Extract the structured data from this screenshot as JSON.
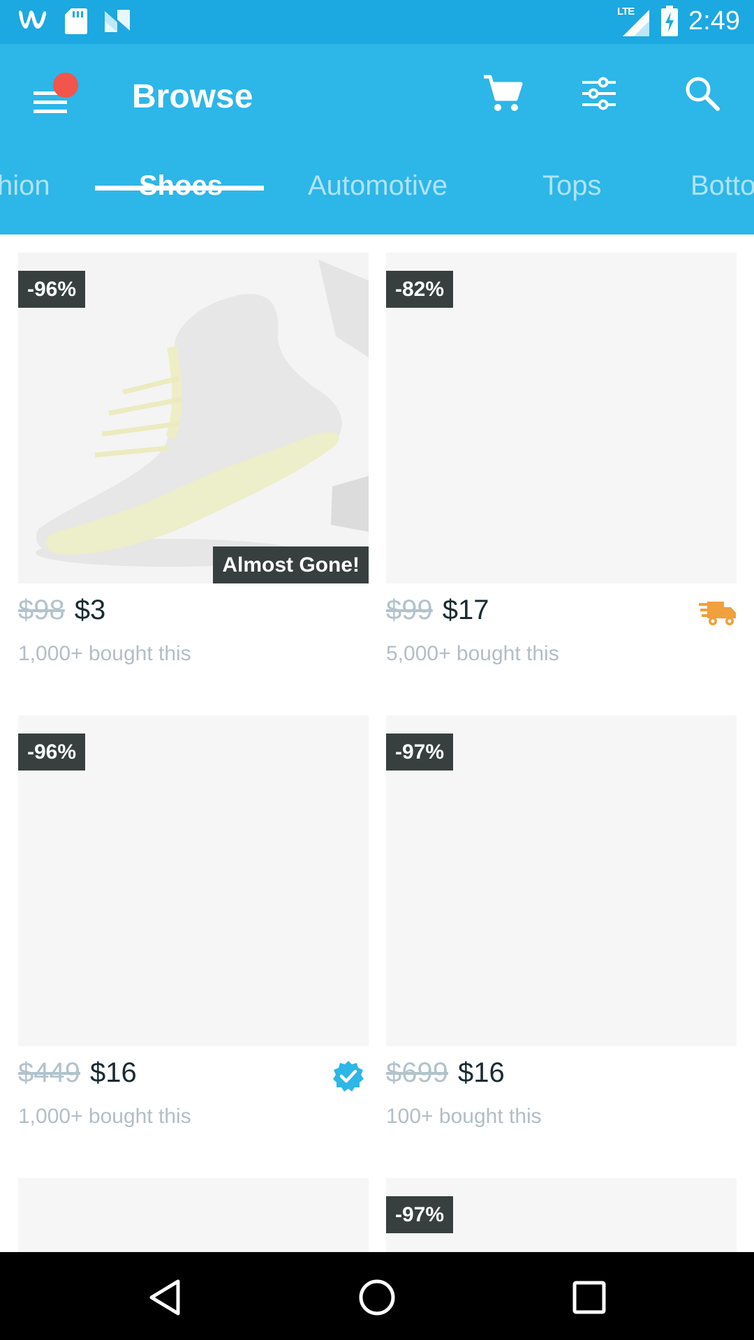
{
  "status_bar": {
    "time": "2:49",
    "network_label": "LTE",
    "left_icons": [
      "wish-logo-icon",
      "sd-card-icon",
      "n-logo-icon"
    ],
    "right_icons": [
      "lte-signal-icon",
      "battery-charging-icon"
    ]
  },
  "app_bar": {
    "title": "Browse",
    "background_color": "#2db6e8",
    "status_bar_color": "#1ca8e0",
    "notification_dot_color": "#f2554c",
    "actions": [
      "cart-icon",
      "filter-icon",
      "search-icon"
    ]
  },
  "tabs": {
    "items": [
      {
        "label": "hion"
      },
      {
        "label": "Shoes",
        "active": true
      },
      {
        "label": "Automotive"
      },
      {
        "label": "Tops"
      },
      {
        "label": "Botto"
      }
    ]
  },
  "products": [
    {
      "discount": "-96%",
      "old_price": "$98",
      "price": "$3",
      "bought": "1,000+ bought this",
      "tag": "Almost Gone!",
      "icon": "shoe-image"
    },
    {
      "discount": "-82%",
      "old_price": "$99",
      "price": "$17",
      "bought": "5,000+ bought this",
      "icon": "fast-shipping-truck-icon"
    },
    {
      "discount": "-96%",
      "old_price": "$449",
      "price": "$16",
      "bought": "1,000+ bought this",
      "icon": "verified-badge-icon"
    },
    {
      "discount": "-97%",
      "old_price": "$699",
      "price": "$16",
      "bought": "100+ bought this"
    },
    {
      "discount": ""
    },
    {
      "discount": "-97%"
    }
  ],
  "colors": {
    "badge_bg": "#38403f",
    "old_price": "#b2c3cc",
    "price": "#192a32",
    "truck": "#f0a03c",
    "verified": "#2db6e8"
  },
  "nav_bar": {
    "buttons": [
      "back-icon",
      "home-icon",
      "recents-icon"
    ]
  }
}
